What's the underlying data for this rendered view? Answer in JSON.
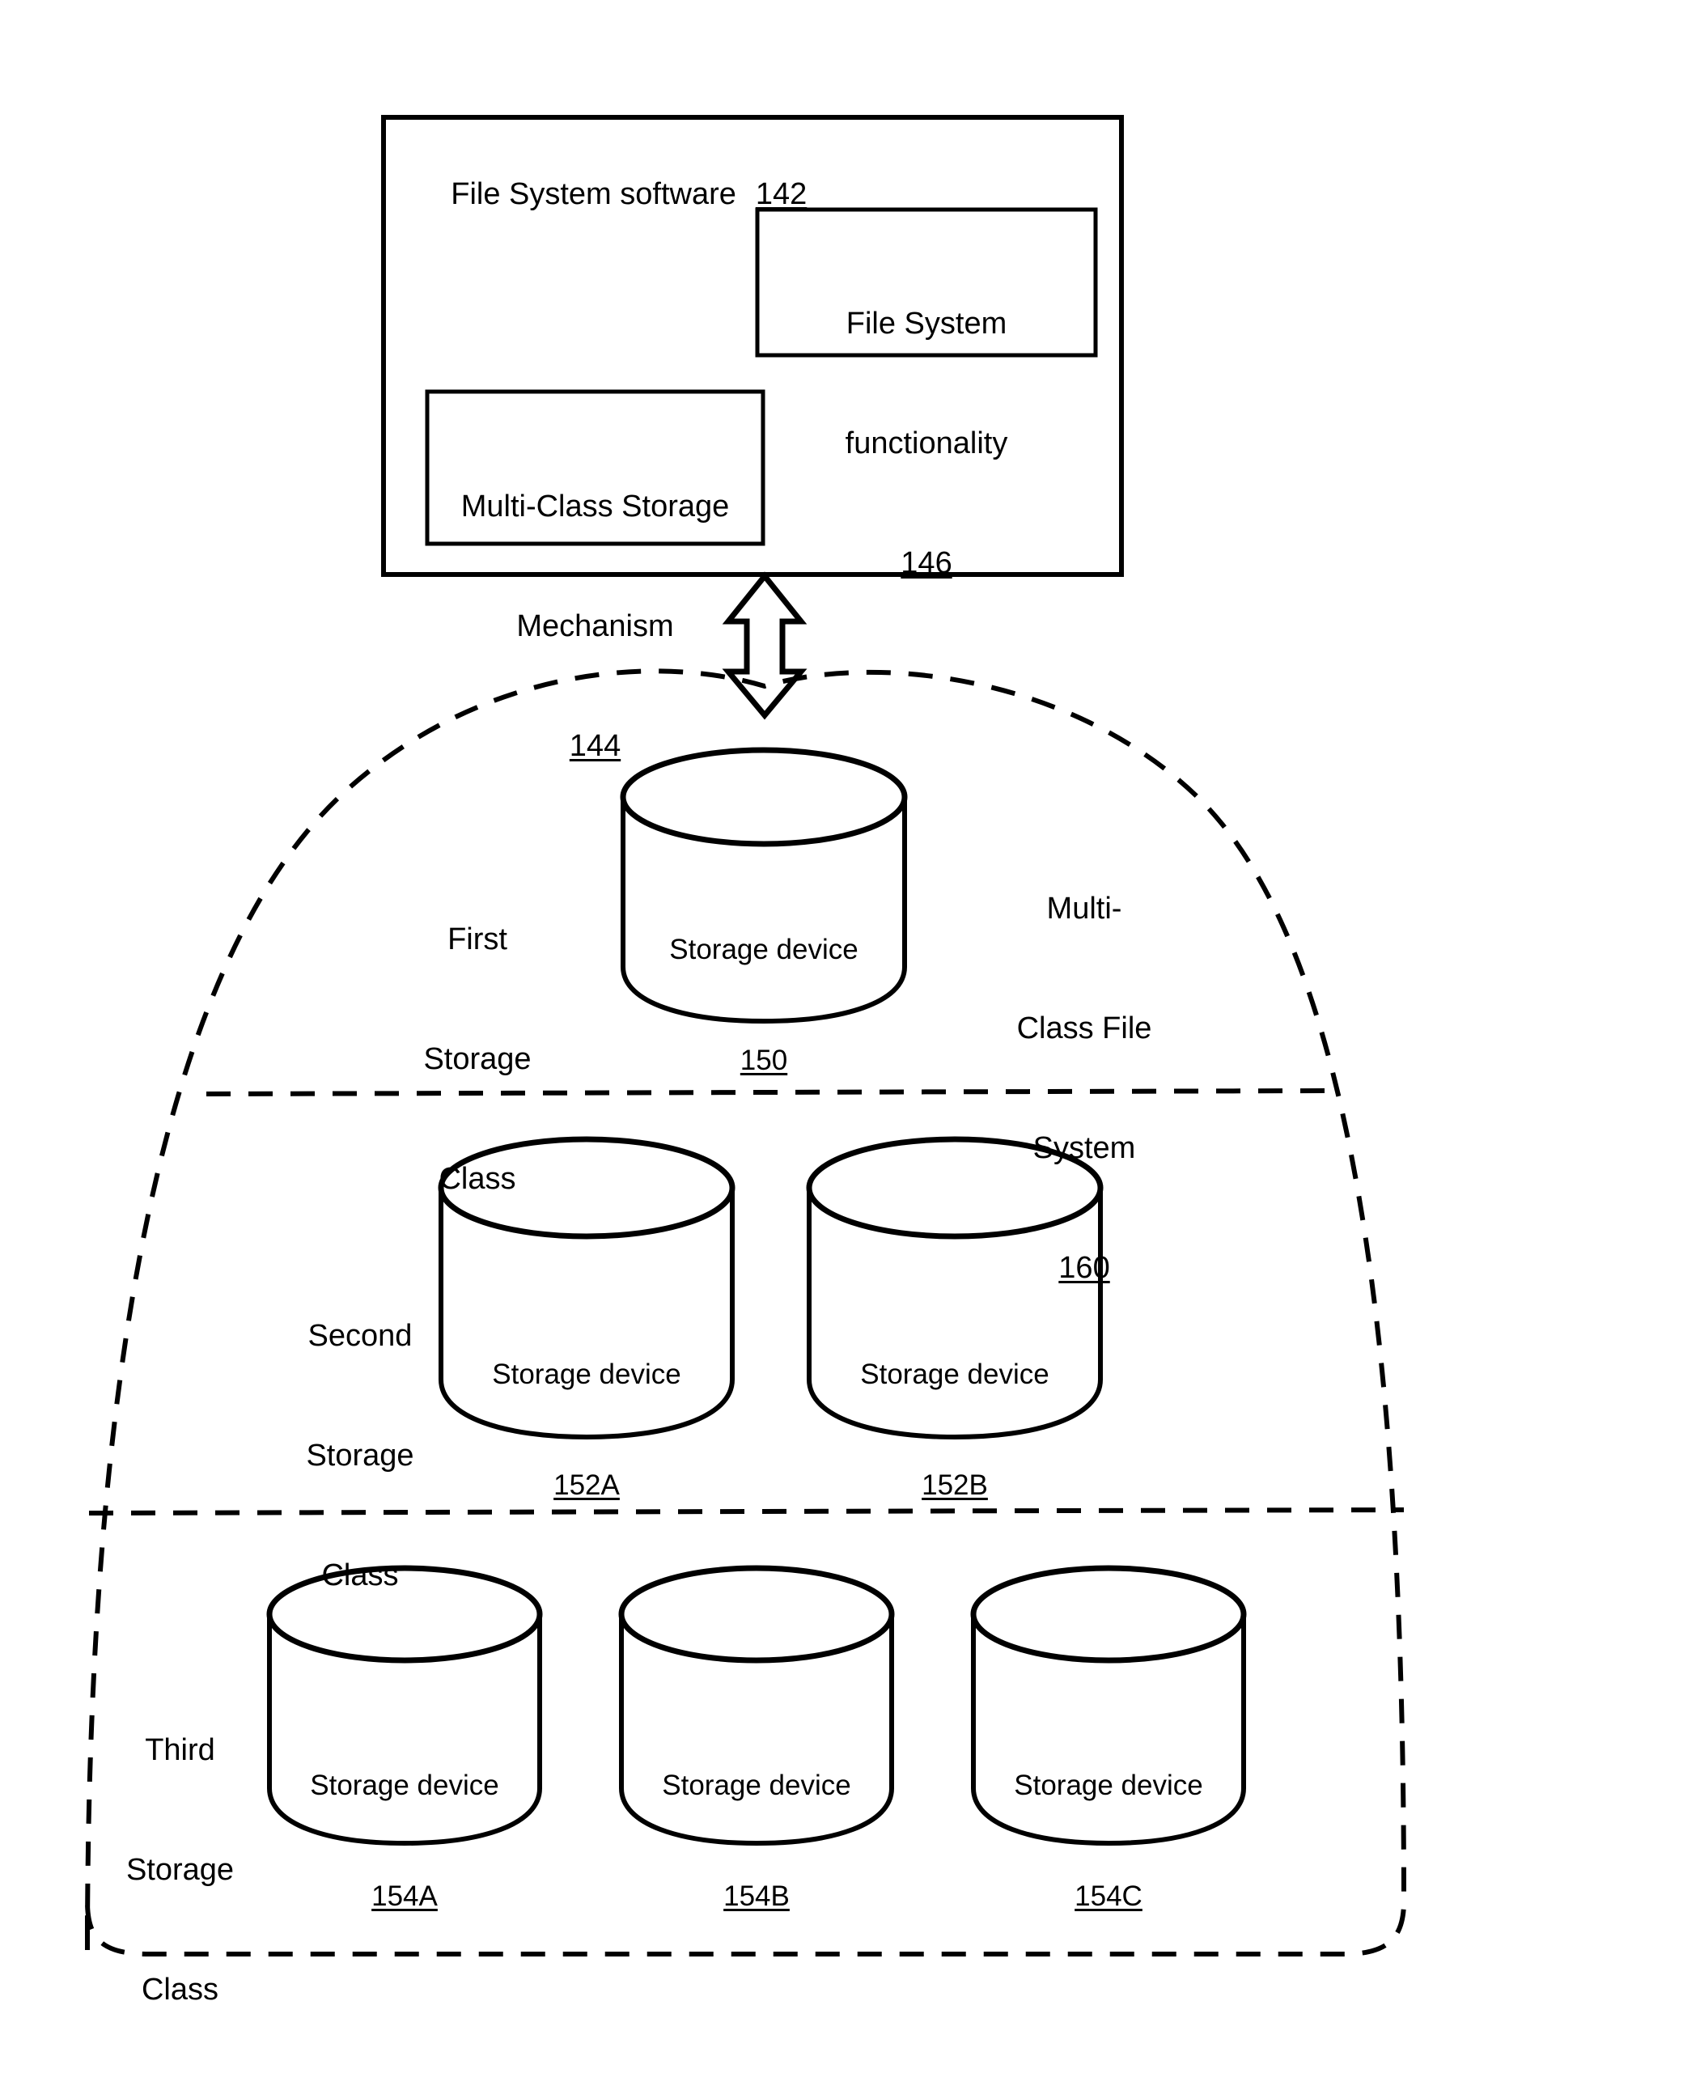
{
  "figure": {
    "type": "patent-diagram",
    "background_color": "#ffffff",
    "line_color": "#000000"
  },
  "software_box": {
    "title": "File System software",
    "title_ref": "142",
    "inner_boxes": [
      {
        "line1": "File System",
        "line2": "functionality",
        "ref": "146"
      },
      {
        "line1": "Multi-Class Storage",
        "line2": "Mechanism",
        "ref": "144"
      }
    ]
  },
  "connector": {
    "kind": "double-headed-vertical-arrow"
  },
  "file_system": {
    "label_line1": "Multi-",
    "label_line2": "Class File",
    "label_line3": "System",
    "label_ref": "160"
  },
  "storage_classes": [
    {
      "name_line1": "First",
      "name_line2": "Storage",
      "name_line3": "Class",
      "devices": [
        {
          "label": "Storage device",
          "ref": "150"
        }
      ]
    },
    {
      "name_line1": "Second",
      "name_line2": "Storage",
      "name_line3": "Class",
      "devices": [
        {
          "label": "Storage device",
          "ref": "152A"
        },
        {
          "label": "Storage device",
          "ref": "152B"
        }
      ]
    },
    {
      "name_line1": "Third",
      "name_line2": "Storage",
      "name_line3": "Class",
      "devices": [
        {
          "label": "Storage device",
          "ref": "154A"
        },
        {
          "label": "Storage device",
          "ref": "154B"
        },
        {
          "label": "Storage device",
          "ref": "154C"
        }
      ]
    }
  ]
}
